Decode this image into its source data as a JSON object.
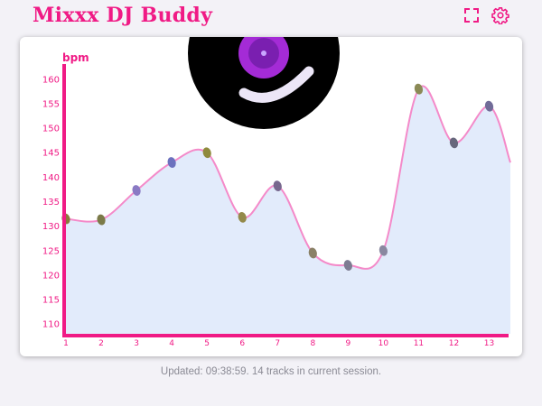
{
  "app": {
    "title": "Mixxx DJ Buddy",
    "accent_color": "#f01a85"
  },
  "header": {
    "icons": [
      "fullscreen-icon",
      "gear-icon"
    ]
  },
  "footer": {
    "status_text": "Updated: 09:38:59. 14 tracks in current session."
  },
  "colors": {
    "axis": "#f01a85",
    "line": "#f48ac9",
    "area_fill": "#e2ebfb",
    "vinyl": "#000000",
    "vinyl_label": "#a42bd6"
  },
  "chart_data": {
    "type": "area",
    "ylabel": "bpm",
    "xlabel": "",
    "x": [
      1,
      2,
      3,
      4,
      5,
      6,
      7,
      8,
      9,
      10,
      11,
      12,
      13
    ],
    "values": [
      131.5,
      131.3,
      137.3,
      143.0,
      145.0,
      131.8,
      138.2,
      124.5,
      122.0,
      125.0,
      158.0,
      147.0,
      154.5
    ],
    "ylim": [
      108,
      162
    ],
    "yticks": [
      110,
      115,
      120,
      125,
      130,
      135,
      140,
      145,
      150,
      155,
      160
    ],
    "grid": false,
    "marker_colors": [
      "#8a7a3c",
      "#7b7a48",
      "#8a7ac4",
      "#6c71be",
      "#8f8a3c",
      "#948a4a",
      "#78688e",
      "#8a8066",
      "#7e7c92",
      "#8a88a0",
      "#8b8a56",
      "#67677c",
      "#716c98"
    ]
  }
}
